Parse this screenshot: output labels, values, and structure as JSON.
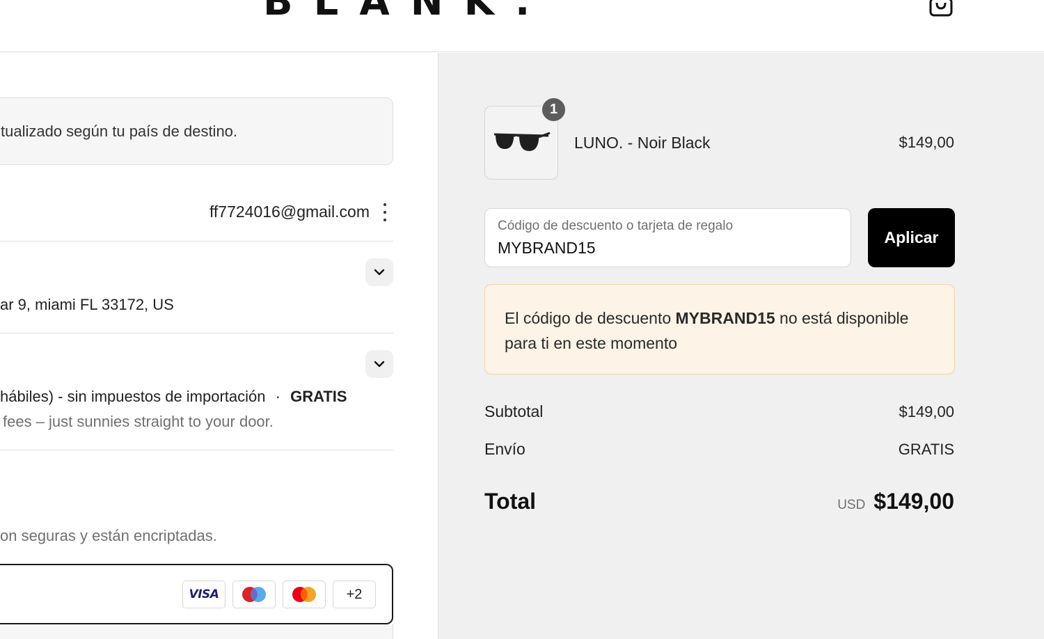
{
  "header": {
    "logo": "BLANK.",
    "cart_icon": "shopping-bag-icon"
  },
  "left": {
    "notice_text": "tualizado según tu país de destino.",
    "contact_email": "ff7724016@gmail.com",
    "menu_icon": "more-vertical-icon",
    "ship_to_address": "ar 9, miami FL 33172, US",
    "shipping_method": "hábiles) - sin impuestos de importación",
    "shipping_separator": "·",
    "shipping_price": "GRATIS",
    "shipping_note": "fees – just sunnies straight to your door.",
    "payment_secure_text": "on seguras y están encriptadas.",
    "payment_cards": [
      "VISA",
      "Maestro",
      "Mastercard",
      "+2"
    ]
  },
  "summary": {
    "item": {
      "quantity": "1",
      "name": "LUNO. - Noir Black",
      "price": "$149,00",
      "image_icon": "sunglasses-icon"
    },
    "discount": {
      "label": "Código de descuento o tarjeta de regalo",
      "value": "MYBRAND15",
      "apply_label": "Aplicar"
    },
    "alert": {
      "prefix": "El código de descuento ",
      "code": "MYBRAND15",
      "suffix": " no está disponible para ti en este momento"
    },
    "subtotal_label": "Subtotal",
    "subtotal_value": "$149,00",
    "shipping_label": "Envío",
    "shipping_value": "GRATIS",
    "total_label": "Total",
    "total_currency": "USD",
    "total_value": "$149,00"
  },
  "colors": {
    "summary_background": "#f0f0f0",
    "button_background": "#000000",
    "alert_background": "#fdf3e6",
    "alert_border": "#f2d4a6"
  }
}
